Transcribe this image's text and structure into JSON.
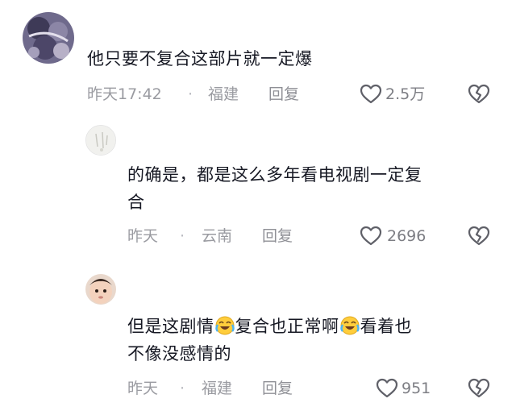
{
  "comments": [
    {
      "text_lines": [
        "他只要不复合这部片就一定爆"
      ],
      "time": "昨天17:42",
      "dot": "·",
      "location": "福建",
      "reply_label": "回复",
      "likes": "2.5万"
    },
    {
      "text_lines": [
        "的确是，都是这么多年看电视剧一定复",
        "合"
      ],
      "time": "昨天",
      "dot": "·",
      "location": "云南",
      "reply_label": "回复",
      "likes": "2696"
    },
    {
      "text_parts": [
        "但是这剧情",
        "复合也正常啊",
        "看着也"
      ],
      "text_line2": "不像没感情的",
      "time": "昨天",
      "dot": "·",
      "location": "福建",
      "reply_label": "回复",
      "likes": "951"
    }
  ],
  "colors": {
    "text": "#161823",
    "meta": "#9a9ba1",
    "icon": "#5f6068"
  }
}
